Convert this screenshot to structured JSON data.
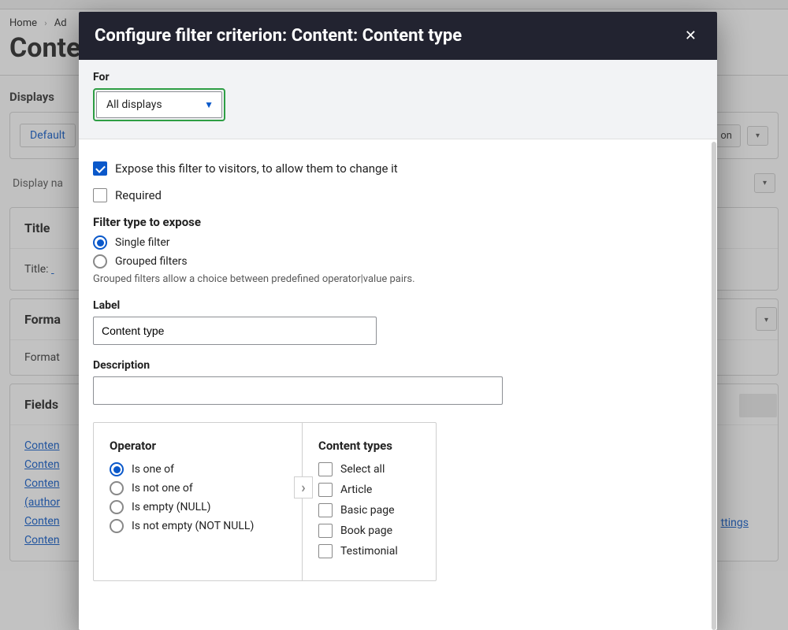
{
  "breadcrumbs": {
    "home": "Home",
    "next_fragment": "Ad"
  },
  "page_title_fragment": "Conte",
  "displays_heading": "Displays",
  "tabs": {
    "default": "Default",
    "right_fragment": "on"
  },
  "display_name_label": "Display na",
  "panels": {
    "title": {
      "heading": "Title",
      "label": "Title:"
    },
    "format": {
      "heading": "Forma",
      "label": "Format"
    },
    "fields": {
      "heading": "Fields",
      "items": [
        "Conten",
        "Conten",
        "Conten"
      ],
      "author": "(author",
      "more": [
        "Conten",
        "Conten"
      ]
    }
  },
  "right_link_fragment": "ttings",
  "modal": {
    "title": "Configure filter criterion: Content: Content type",
    "for_label": "For",
    "for_value": "All displays",
    "expose_label": "Expose this filter to visitors, to allow them to change it",
    "expose_checked": true,
    "required_label": "Required",
    "required_checked": false,
    "filter_type_heading": "Filter type to expose",
    "filter_type": {
      "single": "Single filter",
      "grouped": "Grouped filters",
      "selected": "single",
      "hint": "Grouped filters allow a choice between predefined operator|value pairs."
    },
    "label_field": {
      "label": "Label",
      "value": "Content type"
    },
    "description_field": {
      "label": "Description",
      "value": ""
    },
    "operator": {
      "heading": "Operator",
      "options": [
        {
          "key": "is_one_of",
          "label": "Is one of"
        },
        {
          "key": "is_not_one_of",
          "label": "Is not one of"
        },
        {
          "key": "is_empty",
          "label": "Is empty (NULL)"
        },
        {
          "key": "is_not_empty",
          "label": "Is not empty (NOT NULL)"
        }
      ],
      "selected": "is_one_of"
    },
    "content_types": {
      "heading": "Content types",
      "options": [
        {
          "key": "select_all",
          "label": "Select all",
          "checked": false
        },
        {
          "key": "article",
          "label": "Article",
          "checked": false
        },
        {
          "key": "basic_page",
          "label": "Basic page",
          "checked": false
        },
        {
          "key": "book_page",
          "label": "Book page",
          "checked": false
        },
        {
          "key": "testimonial",
          "label": "Testimonial",
          "checked": false
        }
      ]
    }
  }
}
